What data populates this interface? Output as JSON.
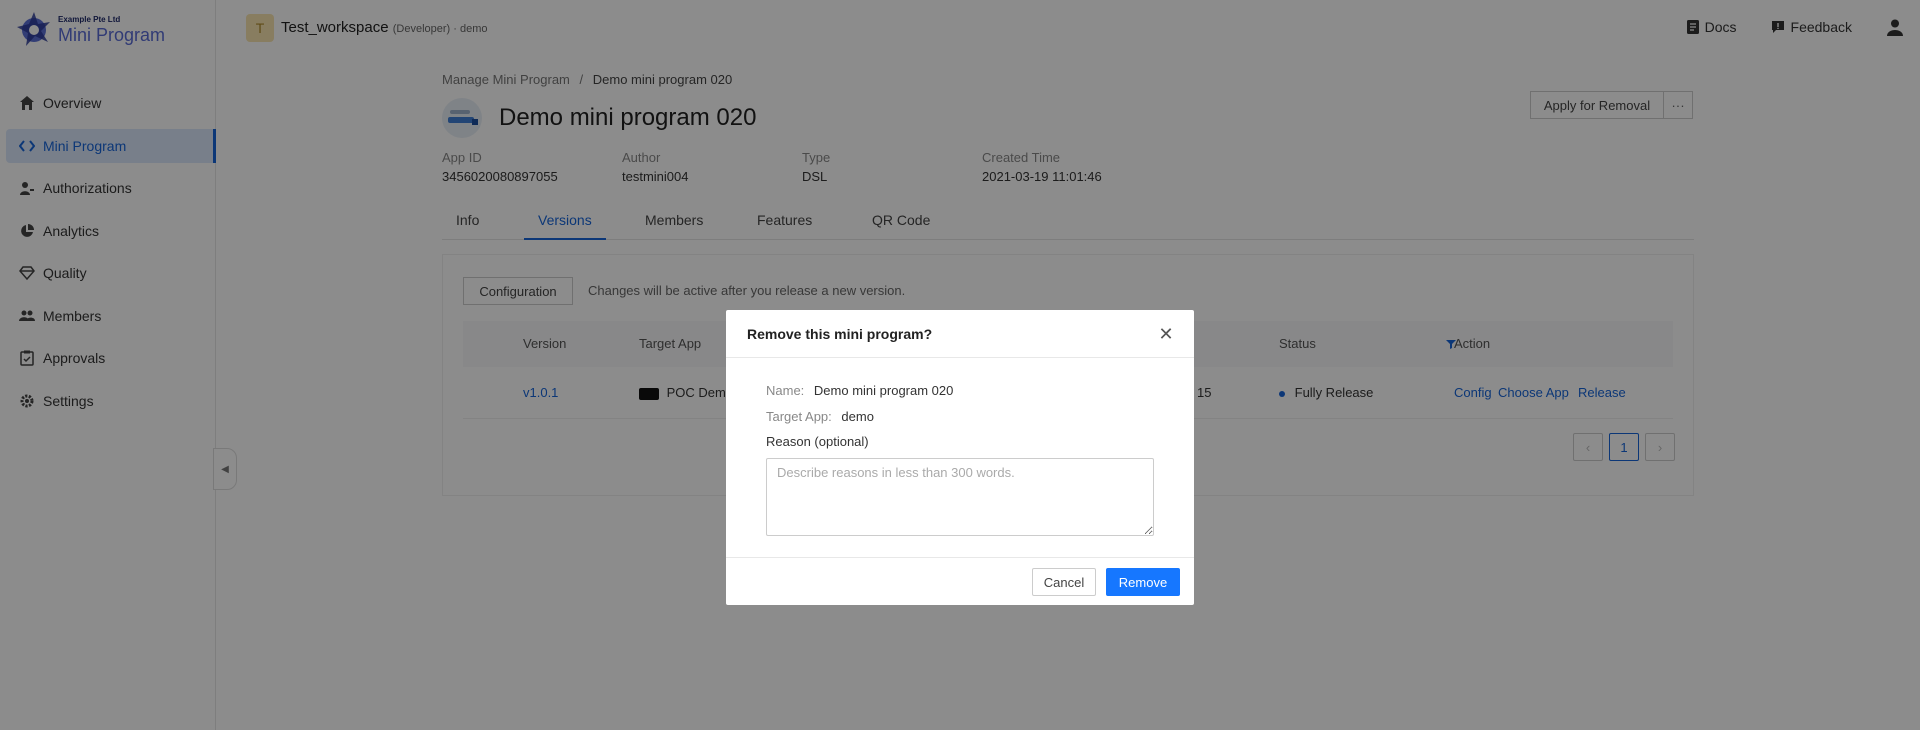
{
  "brand": {
    "company": "Example Pte Ltd",
    "product": "Mini Program"
  },
  "sidebar": {
    "items": [
      {
        "label": "Overview",
        "icon": "home-icon"
      },
      {
        "label": "Mini Program",
        "icon": "code-icon",
        "active": true
      },
      {
        "label": "Authorizations",
        "icon": "user-key-icon"
      },
      {
        "label": "Analytics",
        "icon": "pie-chart-icon"
      },
      {
        "label": "Quality",
        "icon": "diamond-icon"
      },
      {
        "label": "Members",
        "icon": "people-icon"
      },
      {
        "label": "Approvals",
        "icon": "clipboard-icon"
      },
      {
        "label": "Settings",
        "icon": "gear-icon"
      }
    ]
  },
  "topbar": {
    "workspace_initial": "T",
    "workspace_name": "Test_workspace",
    "workspace_meta": "(Developer) · demo",
    "docs": "Docs",
    "feedback": "Feedback"
  },
  "breadcrumb": {
    "parent": "Manage Mini Program",
    "separator": "/",
    "current": "Demo mini program 020"
  },
  "page": {
    "title": "Demo mini program 020",
    "apply_removal": "Apply for Removal",
    "more": "···"
  },
  "meta": {
    "app_id_label": "App ID",
    "app_id": "3456020080897055",
    "author_label": "Author",
    "author": "testmini004",
    "type_label": "Type",
    "type": "DSL",
    "created_label": "Created Time",
    "created": "2021-03-19 11:01:46"
  },
  "tabs": [
    "Info",
    "Versions",
    "Members",
    "Features",
    "QR Code"
  ],
  "versions": {
    "config_button": "Configuration",
    "config_note": "Changes will be active after you release a new version.",
    "columns": [
      "Version",
      "Target App",
      "Status",
      "Action"
    ],
    "row": {
      "version": "v1.0.1",
      "target_app": "POC Demo",
      "partial": "15",
      "status": "Fully Release",
      "actions": [
        "Config",
        "Choose App",
        "Release"
      ]
    },
    "pagination": {
      "prev": "‹",
      "page": "1",
      "next": "›"
    }
  },
  "modal": {
    "title": "Remove this mini program?",
    "close": "✕",
    "name_label": "Name:",
    "name_value": "Demo mini program 020",
    "target_label": "Target App:",
    "target_value": "demo",
    "reason_label": "Reason (optional)",
    "reason_placeholder": "Describe reasons in less than 300 words.",
    "reason_value": "",
    "cancel": "Cancel",
    "remove": "Remove"
  },
  "colors": {
    "accent": "#1664d9",
    "primary_button": "#1677ff",
    "overlay": "rgba(0,0,0,0.45)"
  }
}
